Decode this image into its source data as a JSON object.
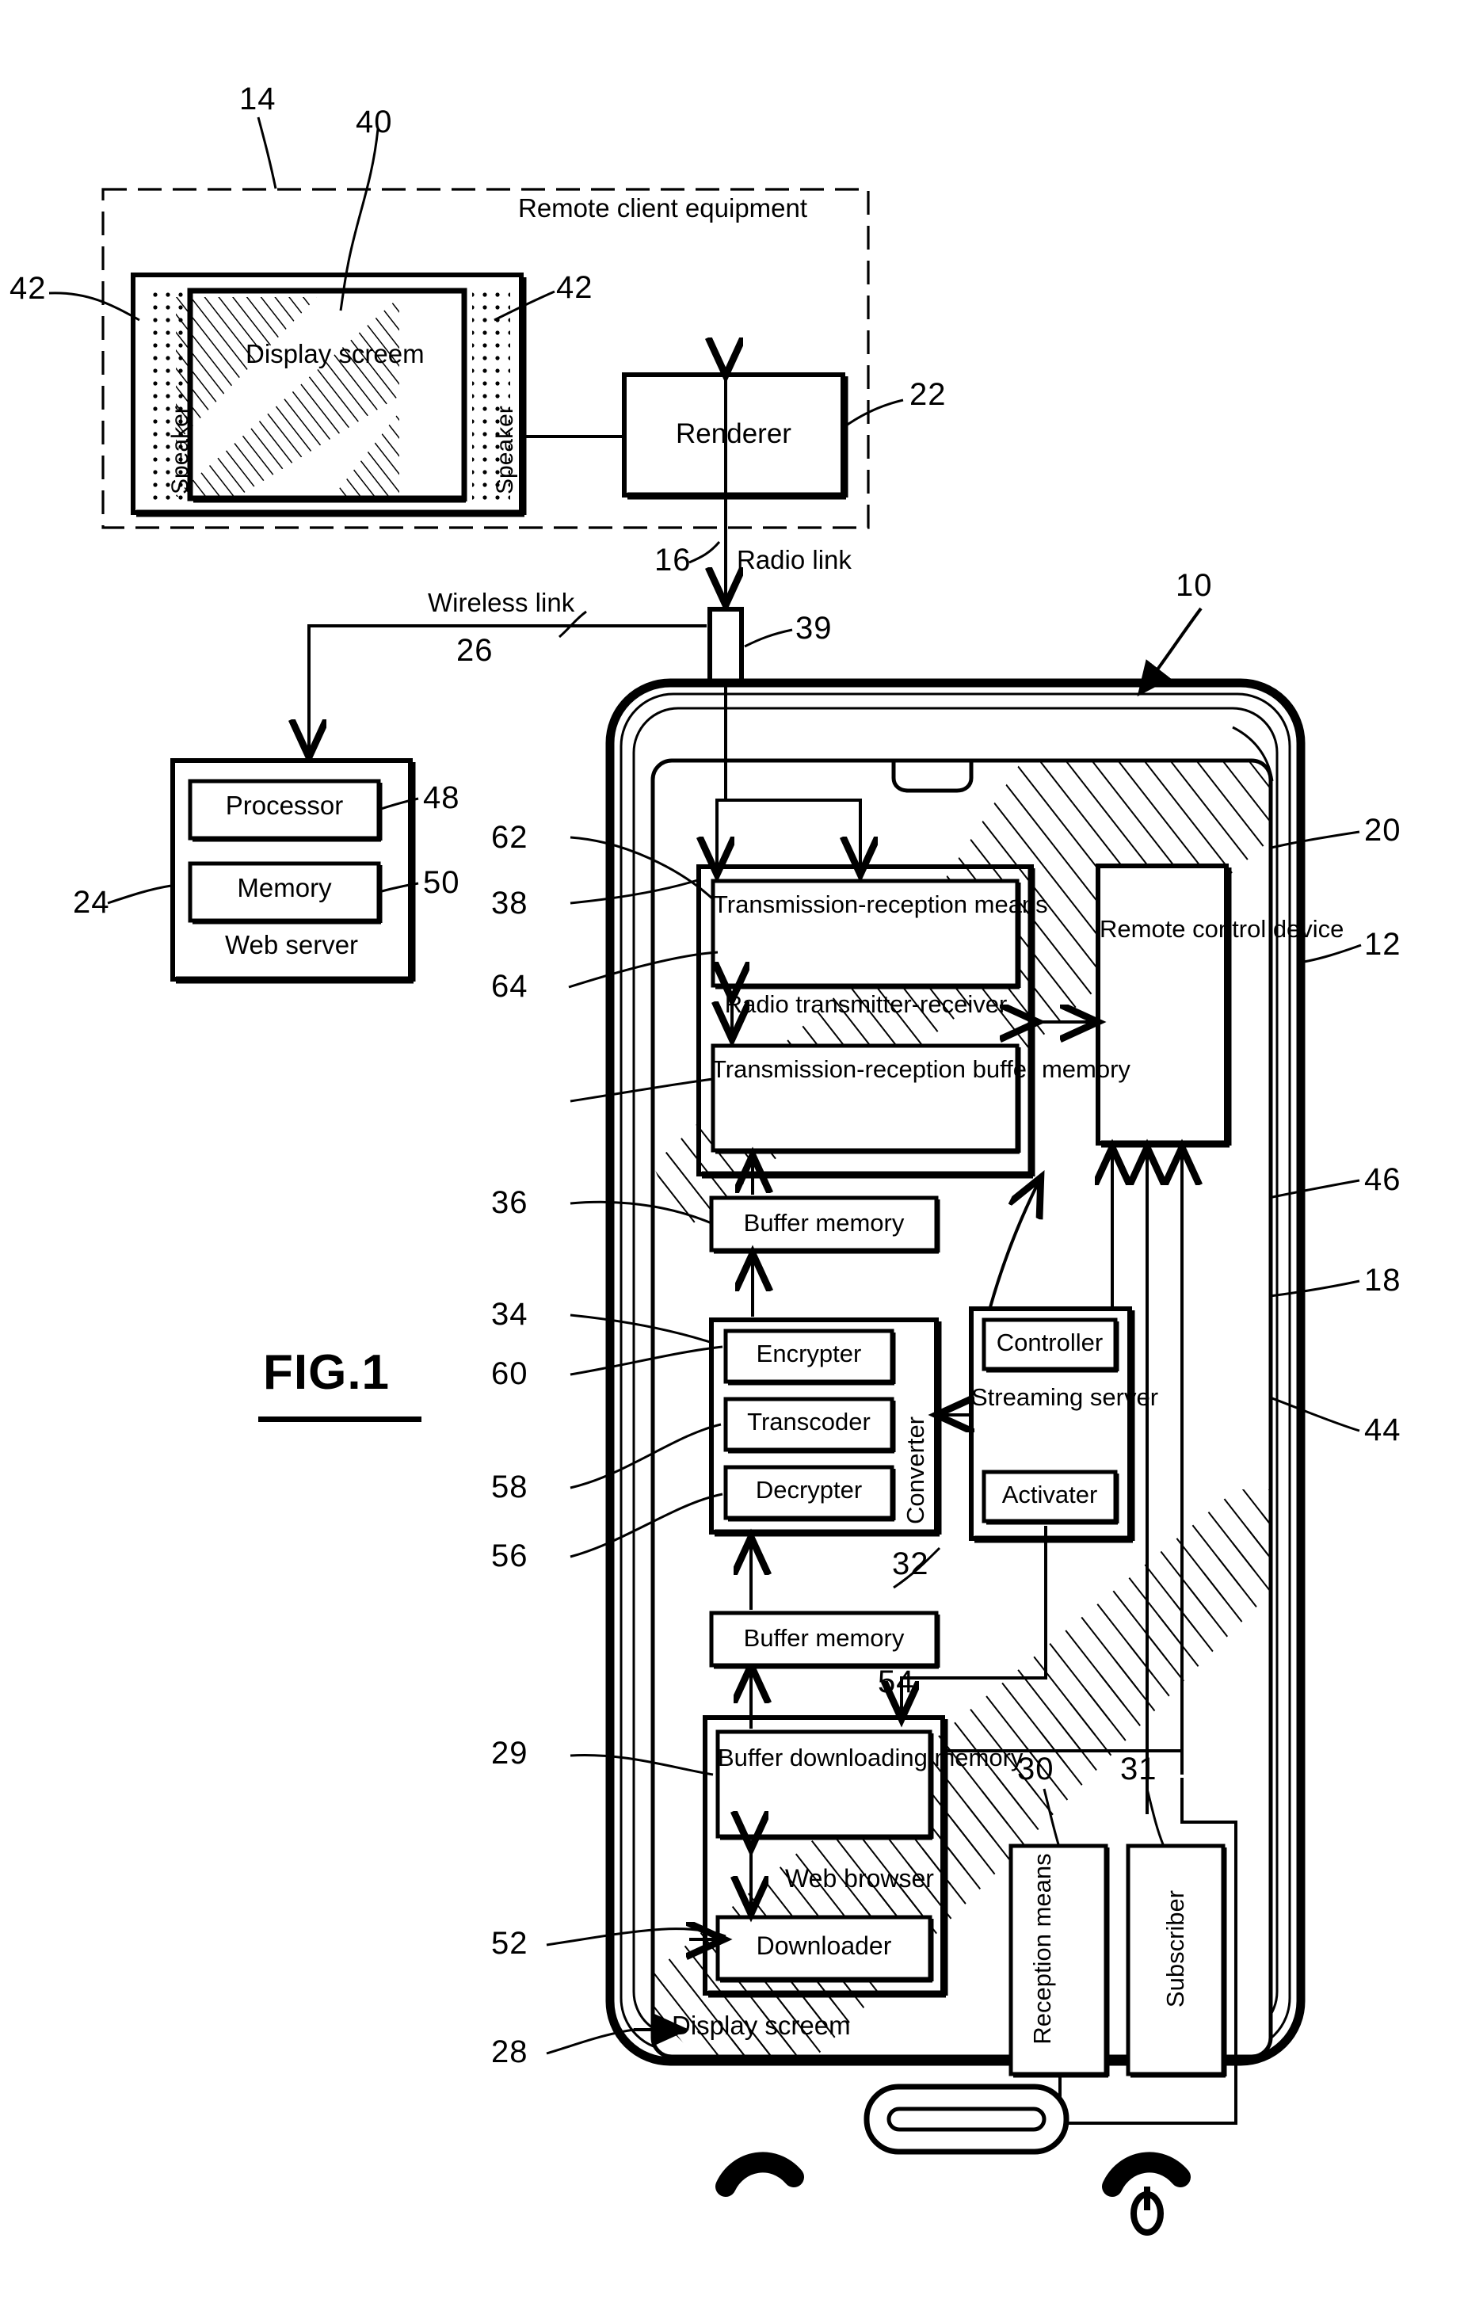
{
  "figure": {
    "label": "FIG.1",
    "caption_underline": true
  },
  "remote_client": {
    "title": "Remote client equipment",
    "ref": "14",
    "tv": {
      "screen_label": "Display screem",
      "screen_ref": "40",
      "speaker_left": "Speaker",
      "speaker_right": "Speaker",
      "speaker_ref_left": "42",
      "speaker_ref_right": "42"
    },
    "renderer": {
      "label": "Renderer",
      "ref": "22"
    }
  },
  "links": {
    "radio": {
      "label": "Radio link",
      "ref": "16"
    },
    "wireless": {
      "label": "Wireless link",
      "ref": "26"
    },
    "antenna_ref": "39"
  },
  "web_server": {
    "title": "Web server",
    "ref": "24",
    "processor": {
      "label": "Processor",
      "ref": "48"
    },
    "memory": {
      "label": "Memory",
      "ref": "50"
    }
  },
  "phone": {
    "device_ref": "10",
    "body_ref": "12",
    "screen_label": "Display screem",
    "screen_ref": "28",
    "radio_tx_rx": {
      "label": "Radio transmitter-receiver",
      "ref": "38",
      "tx_rx_means": {
        "label": "Transmission-reception means",
        "ref": "62"
      },
      "tx_rx_buffer": {
        "label": "Transmission-reception buffer memory",
        "ref": "64"
      }
    },
    "buffer_memory_upper": {
      "label": "Buffer memory",
      "ref": "36"
    },
    "converter": {
      "label": "Converter",
      "ref": "34",
      "encrypter": {
        "label": "Encrypter",
        "ref": "60"
      },
      "transcoder": {
        "label": "Transcoder",
        "ref": "58"
      },
      "decrypter": {
        "label": "Decrypter",
        "ref": "56"
      }
    },
    "buffer_memory_lower": {
      "label": "Buffer memory",
      "ref": "32"
    },
    "web_browser": {
      "label": "Web browser",
      "ref": "29",
      "buffer_downloading_memory": {
        "label": "Buffer downloading memory",
        "ref": "54"
      },
      "downloader": {
        "label": "Downloader",
        "ref": "52"
      }
    },
    "streaming_server": {
      "label": "Streaming server",
      "ref": "18",
      "controller": {
        "label": "Controller",
        "ref": "46"
      },
      "activater": {
        "label": "Activater",
        "ref": "44"
      }
    },
    "remote_control_device": {
      "label": "Remote control device",
      "ref": "20"
    },
    "reception_means": {
      "label": "Reception means",
      "ref": "30"
    },
    "subscriber": {
      "label": "Subscriber",
      "ref": "31"
    }
  }
}
